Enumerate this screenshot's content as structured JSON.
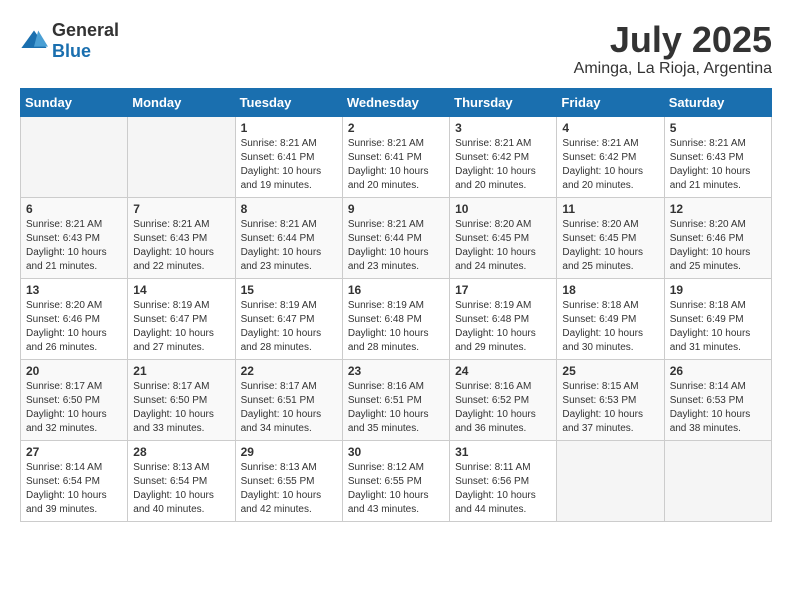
{
  "logo": {
    "general": "General",
    "blue": "Blue"
  },
  "title": "July 2025",
  "subtitle": "Aminga, La Rioja, Argentina",
  "days_of_week": [
    "Sunday",
    "Monday",
    "Tuesday",
    "Wednesday",
    "Thursday",
    "Friday",
    "Saturday"
  ],
  "weeks": [
    [
      {
        "day": "",
        "info": ""
      },
      {
        "day": "",
        "info": ""
      },
      {
        "day": "1",
        "sunrise": "Sunrise: 8:21 AM",
        "sunset": "Sunset: 6:41 PM",
        "daylight": "Daylight: 10 hours and 19 minutes."
      },
      {
        "day": "2",
        "sunrise": "Sunrise: 8:21 AM",
        "sunset": "Sunset: 6:41 PM",
        "daylight": "Daylight: 10 hours and 20 minutes."
      },
      {
        "day": "3",
        "sunrise": "Sunrise: 8:21 AM",
        "sunset": "Sunset: 6:42 PM",
        "daylight": "Daylight: 10 hours and 20 minutes."
      },
      {
        "day": "4",
        "sunrise": "Sunrise: 8:21 AM",
        "sunset": "Sunset: 6:42 PM",
        "daylight": "Daylight: 10 hours and 20 minutes."
      },
      {
        "day": "5",
        "sunrise": "Sunrise: 8:21 AM",
        "sunset": "Sunset: 6:43 PM",
        "daylight": "Daylight: 10 hours and 21 minutes."
      }
    ],
    [
      {
        "day": "6",
        "sunrise": "Sunrise: 8:21 AM",
        "sunset": "Sunset: 6:43 PM",
        "daylight": "Daylight: 10 hours and 21 minutes."
      },
      {
        "day": "7",
        "sunrise": "Sunrise: 8:21 AM",
        "sunset": "Sunset: 6:43 PM",
        "daylight": "Daylight: 10 hours and 22 minutes."
      },
      {
        "day": "8",
        "sunrise": "Sunrise: 8:21 AM",
        "sunset": "Sunset: 6:44 PM",
        "daylight": "Daylight: 10 hours and 23 minutes."
      },
      {
        "day": "9",
        "sunrise": "Sunrise: 8:21 AM",
        "sunset": "Sunset: 6:44 PM",
        "daylight": "Daylight: 10 hours and 23 minutes."
      },
      {
        "day": "10",
        "sunrise": "Sunrise: 8:20 AM",
        "sunset": "Sunset: 6:45 PM",
        "daylight": "Daylight: 10 hours and 24 minutes."
      },
      {
        "day": "11",
        "sunrise": "Sunrise: 8:20 AM",
        "sunset": "Sunset: 6:45 PM",
        "daylight": "Daylight: 10 hours and 25 minutes."
      },
      {
        "day": "12",
        "sunrise": "Sunrise: 8:20 AM",
        "sunset": "Sunset: 6:46 PM",
        "daylight": "Daylight: 10 hours and 25 minutes."
      }
    ],
    [
      {
        "day": "13",
        "sunrise": "Sunrise: 8:20 AM",
        "sunset": "Sunset: 6:46 PM",
        "daylight": "Daylight: 10 hours and 26 minutes."
      },
      {
        "day": "14",
        "sunrise": "Sunrise: 8:19 AM",
        "sunset": "Sunset: 6:47 PM",
        "daylight": "Daylight: 10 hours and 27 minutes."
      },
      {
        "day": "15",
        "sunrise": "Sunrise: 8:19 AM",
        "sunset": "Sunset: 6:47 PM",
        "daylight": "Daylight: 10 hours and 28 minutes."
      },
      {
        "day": "16",
        "sunrise": "Sunrise: 8:19 AM",
        "sunset": "Sunset: 6:48 PM",
        "daylight": "Daylight: 10 hours and 28 minutes."
      },
      {
        "day": "17",
        "sunrise": "Sunrise: 8:19 AM",
        "sunset": "Sunset: 6:48 PM",
        "daylight": "Daylight: 10 hours and 29 minutes."
      },
      {
        "day": "18",
        "sunrise": "Sunrise: 8:18 AM",
        "sunset": "Sunset: 6:49 PM",
        "daylight": "Daylight: 10 hours and 30 minutes."
      },
      {
        "day": "19",
        "sunrise": "Sunrise: 8:18 AM",
        "sunset": "Sunset: 6:49 PM",
        "daylight": "Daylight: 10 hours and 31 minutes."
      }
    ],
    [
      {
        "day": "20",
        "sunrise": "Sunrise: 8:17 AM",
        "sunset": "Sunset: 6:50 PM",
        "daylight": "Daylight: 10 hours and 32 minutes."
      },
      {
        "day": "21",
        "sunrise": "Sunrise: 8:17 AM",
        "sunset": "Sunset: 6:50 PM",
        "daylight": "Daylight: 10 hours and 33 minutes."
      },
      {
        "day": "22",
        "sunrise": "Sunrise: 8:17 AM",
        "sunset": "Sunset: 6:51 PM",
        "daylight": "Daylight: 10 hours and 34 minutes."
      },
      {
        "day": "23",
        "sunrise": "Sunrise: 8:16 AM",
        "sunset": "Sunset: 6:51 PM",
        "daylight": "Daylight: 10 hours and 35 minutes."
      },
      {
        "day": "24",
        "sunrise": "Sunrise: 8:16 AM",
        "sunset": "Sunset: 6:52 PM",
        "daylight": "Daylight: 10 hours and 36 minutes."
      },
      {
        "day": "25",
        "sunrise": "Sunrise: 8:15 AM",
        "sunset": "Sunset: 6:53 PM",
        "daylight": "Daylight: 10 hours and 37 minutes."
      },
      {
        "day": "26",
        "sunrise": "Sunrise: 8:14 AM",
        "sunset": "Sunset: 6:53 PM",
        "daylight": "Daylight: 10 hours and 38 minutes."
      }
    ],
    [
      {
        "day": "27",
        "sunrise": "Sunrise: 8:14 AM",
        "sunset": "Sunset: 6:54 PM",
        "daylight": "Daylight: 10 hours and 39 minutes."
      },
      {
        "day": "28",
        "sunrise": "Sunrise: 8:13 AM",
        "sunset": "Sunset: 6:54 PM",
        "daylight": "Daylight: 10 hours and 40 minutes."
      },
      {
        "day": "29",
        "sunrise": "Sunrise: 8:13 AM",
        "sunset": "Sunset: 6:55 PM",
        "daylight": "Daylight: 10 hours and 42 minutes."
      },
      {
        "day": "30",
        "sunrise": "Sunrise: 8:12 AM",
        "sunset": "Sunset: 6:55 PM",
        "daylight": "Daylight: 10 hours and 43 minutes."
      },
      {
        "day": "31",
        "sunrise": "Sunrise: 8:11 AM",
        "sunset": "Sunset: 6:56 PM",
        "daylight": "Daylight: 10 hours and 44 minutes."
      },
      {
        "day": "",
        "info": ""
      },
      {
        "day": "",
        "info": ""
      }
    ]
  ]
}
